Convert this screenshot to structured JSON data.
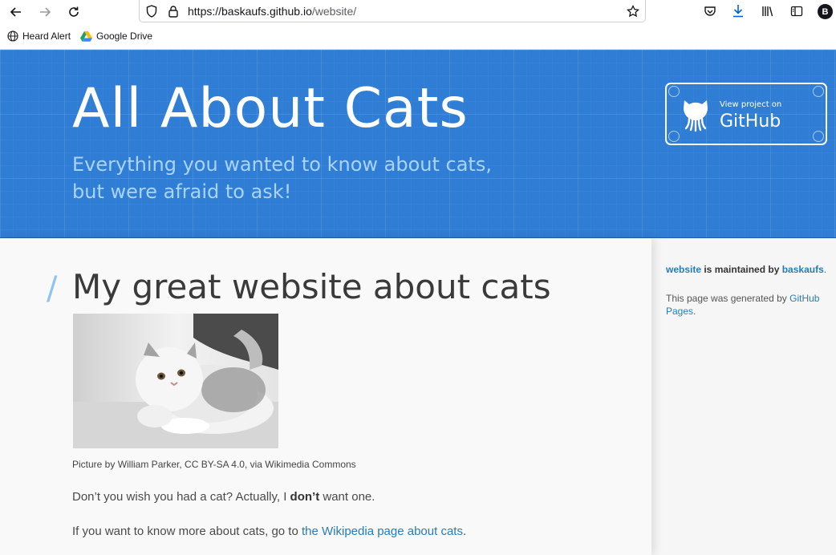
{
  "browser": {
    "url_host": "https://baskaufs.github.io",
    "url_path": "/website/",
    "avatar_letter": "B",
    "bookmarks": [
      {
        "label": "Heard Alert",
        "icon": "globe-icon"
      },
      {
        "label": "Google Drive",
        "icon": "google-drive-icon"
      }
    ]
  },
  "header": {
    "title": "All About Cats",
    "tagline": "Everything you wanted to know about cats, but were afraid to ask!",
    "github_small": "View project on",
    "github_big": "GitHub"
  },
  "main": {
    "heading": "My great website about cats",
    "caption": "Picture by William Parker, CC BY-SA 4.0, via Wikimedia Commons",
    "para1_before": "Don’t you wish you had a cat? Actually, I ",
    "para1_bold": "don’t",
    "para1_after": " want one.",
    "para2_before": "If you want to know more about cats, go to ",
    "para2_link": "the Wikipedia page about cats",
    "para2_after": "."
  },
  "sidebar": {
    "repo_link": "website",
    "maintained_text": " is maintained by ",
    "owner_link": "baskaufs",
    "period": ".",
    "generated_text": "This page was generated by ",
    "pages_link": "GitHub Pages",
    "generated_end": "."
  },
  "colors": {
    "header_blue": "#2f7dd4",
    "tagline_blue": "#a9d4ff",
    "link_blue": "#267cb9"
  }
}
